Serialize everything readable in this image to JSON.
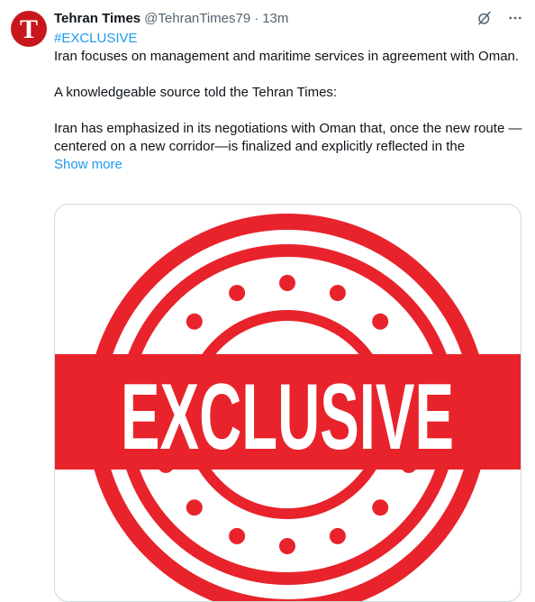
{
  "account": {
    "avatar_letter": "T",
    "display_name": "Tehran Times",
    "handle": "@TehranTimes79",
    "separator": "·",
    "time": "13m"
  },
  "actions": {
    "grok_icon": "grok-icon",
    "more_icon": "more-icon"
  },
  "tweet": {
    "hashtag": "#EXCLUSIVE",
    "line1": "Iran focuses on management and maritime services in agreement with Oman.",
    "line2": "A knowledgeable source told the Tehran Times:",
    "line3": "Iran has emphasized in its negotiations with Oman that, once the new route —centered on a new corridor—is finalized and explicitly reflected in the",
    "show_more": "Show more"
  },
  "media": {
    "stamp_text": "EXCLUSIVE",
    "stamp_color": "#e8232b"
  },
  "colors": {
    "link": "#1d9bf0",
    "secondary": "#536471",
    "brand": "#c8161d"
  }
}
